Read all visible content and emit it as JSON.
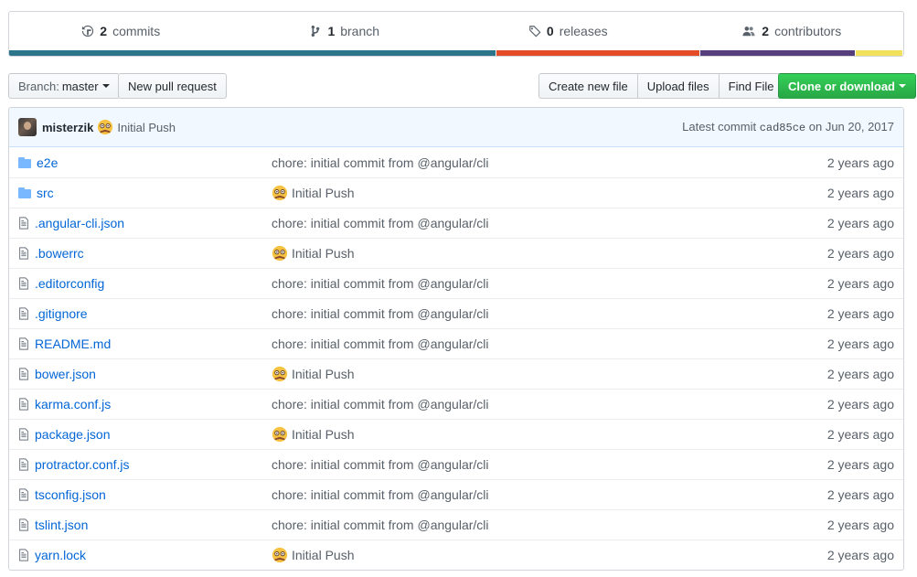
{
  "summary": {
    "commits": {
      "count": "2",
      "label": "commits",
      "icon": "history-icon"
    },
    "branches": {
      "count": "1",
      "label": "branch",
      "icon": "branch-icon"
    },
    "releases": {
      "count": "0",
      "label": "releases",
      "icon": "tag-icon"
    },
    "contributors": {
      "count": "2",
      "label": "contributors",
      "icon": "people-icon"
    },
    "language_colors": [
      "#2b7489",
      "#e34c26",
      "#563d7c",
      "#f1e05a"
    ],
    "language_shares": [
      0.545,
      0.228,
      0.174,
      0.053
    ]
  },
  "toolbar": {
    "branch_prefix": "Branch:",
    "branch_name": "master",
    "new_pull_request": "New pull request",
    "create_new_file": "Create new file",
    "upload_files": "Upload files",
    "find_file": "Find File",
    "clone_or_download": "Clone or download"
  },
  "latest_commit": {
    "author": "misterzik",
    "message": "Initial Push",
    "label": "Latest commit",
    "sha": "cad85ce",
    "date_text": "on Jun 20, 2017"
  },
  "files": [
    {
      "name": "e2e",
      "type": "dir",
      "message": "chore: initial commit from @angular/cli",
      "emoji": false,
      "age": "2 years ago"
    },
    {
      "name": "src",
      "type": "dir",
      "message": "Initial Push",
      "emoji": true,
      "age": "2 years ago"
    },
    {
      "name": ".angular-cli.json",
      "type": "file",
      "message": "chore: initial commit from @angular/cli",
      "emoji": false,
      "age": "2 years ago"
    },
    {
      "name": ".bowerrc",
      "type": "file",
      "message": "Initial Push",
      "emoji": true,
      "age": "2 years ago"
    },
    {
      "name": ".editorconfig",
      "type": "file",
      "message": "chore: initial commit from @angular/cli",
      "emoji": false,
      "age": "2 years ago"
    },
    {
      "name": ".gitignore",
      "type": "file",
      "message": "chore: initial commit from @angular/cli",
      "emoji": false,
      "age": "2 years ago"
    },
    {
      "name": "README.md",
      "type": "file",
      "message": "chore: initial commit from @angular/cli",
      "emoji": false,
      "age": "2 years ago"
    },
    {
      "name": "bower.json",
      "type": "file",
      "message": "Initial Push",
      "emoji": true,
      "age": "2 years ago"
    },
    {
      "name": "karma.conf.js",
      "type": "file",
      "message": "chore: initial commit from @angular/cli",
      "emoji": false,
      "age": "2 years ago"
    },
    {
      "name": "package.json",
      "type": "file",
      "message": "Initial Push",
      "emoji": true,
      "age": "2 years ago"
    },
    {
      "name": "protractor.conf.js",
      "type": "file",
      "message": "chore: initial commit from @angular/cli",
      "emoji": false,
      "age": "2 years ago"
    },
    {
      "name": "tsconfig.json",
      "type": "file",
      "message": "chore: initial commit from @angular/cli",
      "emoji": false,
      "age": "2 years ago"
    },
    {
      "name": "tslint.json",
      "type": "file",
      "message": "chore: initial commit from @angular/cli",
      "emoji": false,
      "age": "2 years ago"
    },
    {
      "name": "yarn.lock",
      "type": "file",
      "message": "Initial Push",
      "emoji": true,
      "age": "2 years ago"
    }
  ]
}
